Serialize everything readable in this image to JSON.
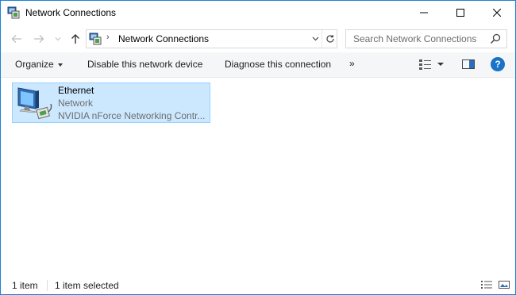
{
  "window": {
    "title": "Network Connections",
    "app_icon": "network-connections-icon"
  },
  "nav": {
    "back_icon": "arrow-left-icon",
    "forward_icon": "arrow-right-icon",
    "recent_icon": "chevron-down-icon",
    "up_icon": "arrow-up-icon",
    "address": {
      "separator": "›",
      "location": "Network Connections"
    },
    "search": {
      "placeholder": "Search Network Connections"
    }
  },
  "commands": {
    "organize": "Organize",
    "disable": "Disable this network device",
    "diagnose": "Diagnose this connection",
    "more": "»"
  },
  "items": [
    {
      "name": "Ethernet",
      "type": "Network",
      "device": "NVIDIA nForce Networking Contr...",
      "icon": "ethernet-adapter-icon",
      "selected": true
    }
  ],
  "status": {
    "count": "1 item",
    "selected": "1 item selected"
  },
  "colors": {
    "accent": "#1883d7",
    "selection": "#cce8ff",
    "selection_border": "#99d1ff",
    "help": "#1a73c7"
  }
}
